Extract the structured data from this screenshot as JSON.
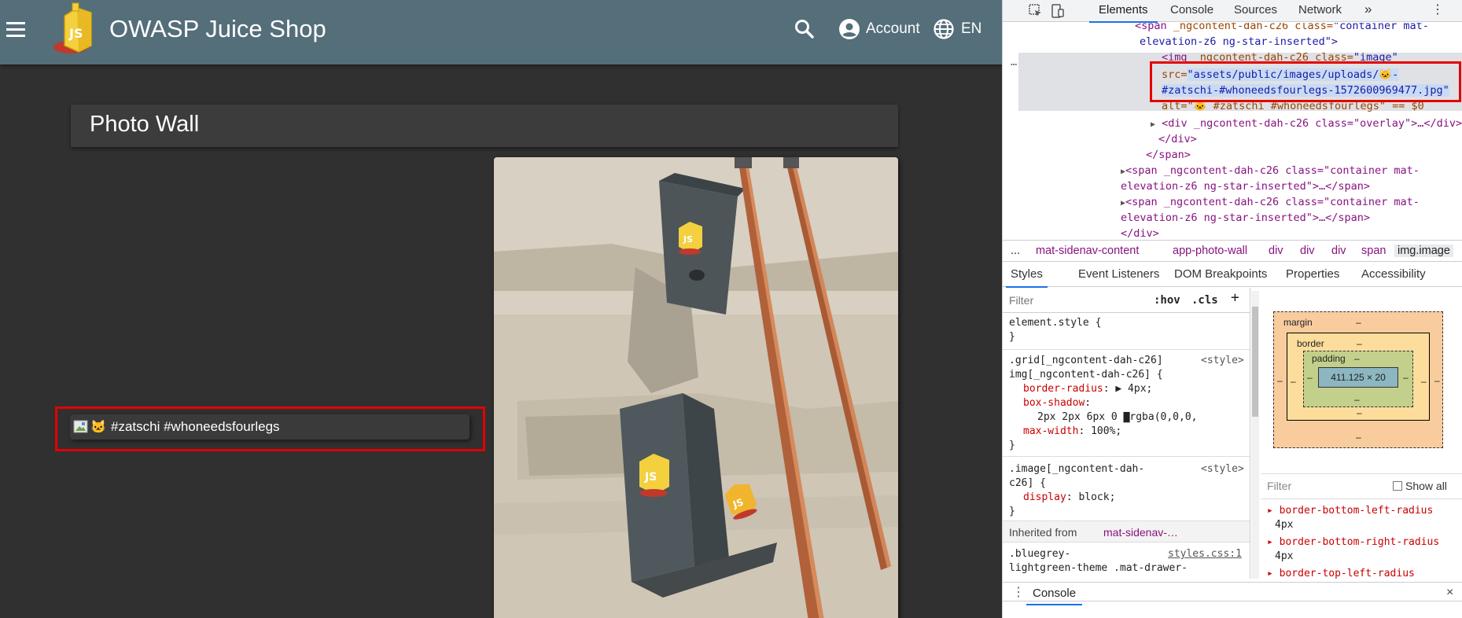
{
  "app": {
    "title": "OWASP Juice Shop",
    "account_label": "Account",
    "language_label": "EN",
    "page_title": "Photo Wall",
    "caption": {
      "emoji": "🐱",
      "text": "#zatschi #whoneedsfourlegs"
    }
  },
  "devtools": {
    "tabs": [
      "Elements",
      "Console",
      "Sources",
      "Network"
    ],
    "more_tabs_glyph": "»",
    "elements": {
      "line1_open": "<span",
      "line1_attrs": " _ngcontent-dah-c26 class=",
      "line1_val": "\"container mat-",
      "line2": "elevation-z6 ng-star-inserted\">",
      "line3_tag": "<img",
      "line3_attr": " _ngcontent-dah-c26 class=",
      "line3_val": "\"image\"",
      "src_attr": "src=",
      "src_val_1": "\"assets/public/images/uploads/🐱-",
      "src_val_2": "#zatschi-#whoneedsfourlegs-1572600969477.jpg\"",
      "alt_line": "alt=\"🐱 #zatschi #whoneedsfourlegs\" == $0",
      "overlay_line": "<div _ngcontent-dah-c26 class=\"overlay\">…</div>",
      "close_div": "</div>",
      "close_span": "</span>",
      "span2_a": "<span _ngcontent-dah-c26 class=\"container mat-",
      "span2_b": "elevation-z6 ng-star-inserted\">…</span>",
      "span3_a": "<span _ngcontent-dah-c26 class=\"container mat-",
      "span3_b": "elevation-z6 ng-star-inserted\">…</span>",
      "trailing": "</div>",
      "dots": "…"
    },
    "breadcrumbs": [
      "...",
      "mat-sidenav-content",
      "app-photo-wall",
      "div",
      "div",
      "div",
      "span",
      "img.image"
    ],
    "sub_tabs": [
      "Styles",
      "Event Listeners",
      "DOM Breakpoints",
      "Properties",
      "Accessibility"
    ],
    "styles": {
      "filter_placeholder": "Filter",
      "hov": ":hov",
      "cls": ".cls",
      "plus": "+",
      "element_style": "element.style {",
      "close_brace": "}",
      "rule1_sel_a": ".grid[_ngcontent-dah-c26]",
      "rule1_src": "<style>",
      "rule1_sel_b": "img[_ngcontent-dah-c26] {",
      "rule1_p1_name": "border-radius",
      "rule1_p1_val": "▶ 4px;",
      "rule1_p2_name": "box-shadow",
      "rule1_p2_val": "2px 2px 6px 0 ▇rgba(0,0,0,",
      "rule1_p3_name": "max-width",
      "rule1_p3_val": "100%;",
      "rule2_sel_a": ".image[_ngcontent-dah-",
      "rule2_src": "<style>",
      "rule2_sel_b": "c26] {",
      "rule2_p1_name": "display",
      "rule2_p1_val": "block;",
      "inherited_label": "Inherited from",
      "inherited_from": "mat-sidenav-…",
      "rule3_sel_a": ".bluegrey-",
      "rule3_src": "styles.css:1",
      "rule3_sel_b": "lightgreen-theme .mat-drawer-"
    },
    "box_model": {
      "margin_label": "margin",
      "border_label": "border",
      "padding_label": "padding",
      "content_size": "411.125 × 20",
      "dash": "–",
      "filter_placeholder": "Filter",
      "show_all": "Show all"
    },
    "computed": [
      {
        "name": "border-bottom-left-radius",
        "value": "4px"
      },
      {
        "name": "border-bottom-right-radius",
        "value": "4px"
      },
      {
        "name": "border-top-left-radius",
        "value": ""
      }
    ],
    "console_tab": "Console",
    "console_close": "×"
  }
}
